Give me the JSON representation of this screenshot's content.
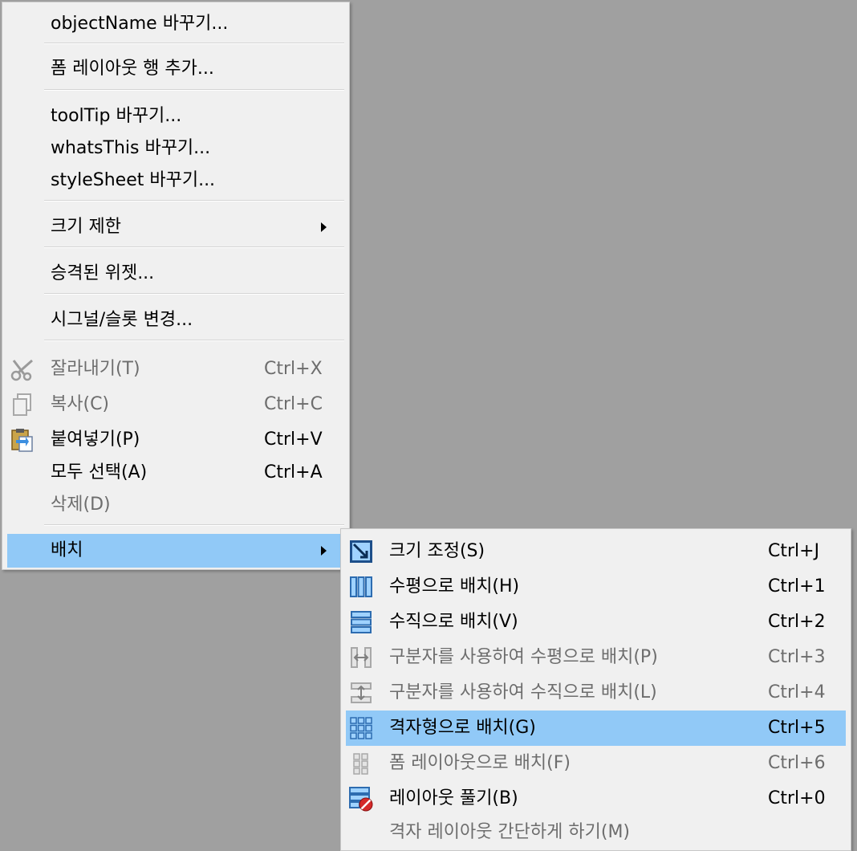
{
  "main_menu": {
    "items": [
      {
        "label": "objectName 바꾸기..."
      },
      {
        "label": "폼 레이아웃 행 추가..."
      },
      {
        "label": "toolTip 바꾸기..."
      },
      {
        "label": "whatsThis 바꾸기..."
      },
      {
        "label": "styleSheet 바꾸기..."
      },
      {
        "label": "크기 제한"
      },
      {
        "label": "승격된 위젯..."
      },
      {
        "label": "시그널/슬롯 변경..."
      },
      {
        "label": "잘라내기(T)",
        "shortcut": "Ctrl+X",
        "icon": "scissors-icon",
        "disabled": true
      },
      {
        "label": "복사(C)",
        "shortcut": "Ctrl+C",
        "icon": "copy-icon",
        "disabled": true
      },
      {
        "label": "붙여넣기(P)",
        "shortcut": "Ctrl+V",
        "icon": "paste-icon"
      },
      {
        "label": "모두 선택(A)",
        "shortcut": "Ctrl+A"
      },
      {
        "label": "삭제(D)",
        "disabled": true
      },
      {
        "label": "배치",
        "highlighted": true
      }
    ]
  },
  "sub_menu": {
    "items": [
      {
        "label": "크기 조정(S)",
        "shortcut": "Ctrl+J",
        "icon": "adjust-size-icon"
      },
      {
        "label": "수평으로 배치(H)",
        "shortcut": "Ctrl+1",
        "icon": "horizontal-layout-icon"
      },
      {
        "label": "수직으로 배치(V)",
        "shortcut": "Ctrl+2",
        "icon": "vertical-layout-icon"
      },
      {
        "label": "구분자를 사용하여 수평으로 배치(P)",
        "shortcut": "Ctrl+3",
        "icon": "horizontal-splitter-icon",
        "disabled": true
      },
      {
        "label": "구분자를 사용하여 수직으로 배치(L)",
        "shortcut": "Ctrl+4",
        "icon": "vertical-splitter-icon",
        "disabled": true
      },
      {
        "label": "격자형으로 배치(G)",
        "shortcut": "Ctrl+5",
        "icon": "grid-layout-icon",
        "highlighted": true
      },
      {
        "label": "폼 레이아웃으로 배치(F)",
        "shortcut": "Ctrl+6",
        "icon": "form-layout-icon",
        "disabled": true
      },
      {
        "label": "레이아웃 풀기(B)",
        "shortcut": "Ctrl+0",
        "icon": "break-layout-icon"
      },
      {
        "label": "격자 레이아웃 간단하게 하기(M)",
        "disabled": true
      }
    ]
  },
  "colors": {
    "highlight": "#91c9f7",
    "menu_bg": "#f0f0f0",
    "desktop_bg": "#a0a0a0",
    "disabled_text": "#6d6d6d"
  }
}
